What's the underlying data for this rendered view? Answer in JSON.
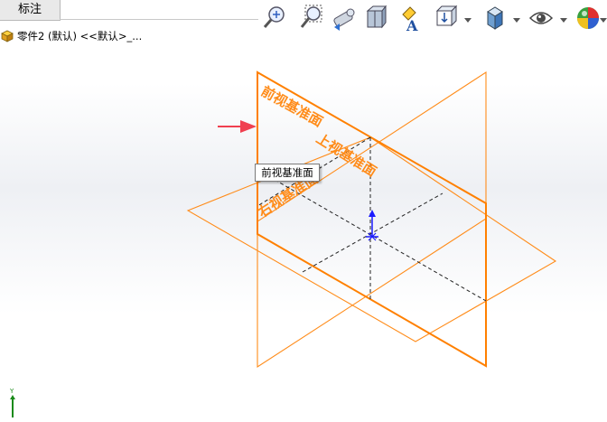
{
  "tabs": {
    "annotation_label": "标注"
  },
  "tree": {
    "part_label": "零件2 (默认) <<默认>_..."
  },
  "planes": {
    "front": "前视基准面",
    "top": "上视基准面",
    "right": "右视基准面"
  },
  "tooltip": {
    "text": "前视基准面"
  },
  "triad": {
    "y_label": "Y"
  },
  "colors": {
    "plane": "#ff8c1a",
    "plane_selected": "#ff8000",
    "pointer_arrow": "#f04050",
    "origin": "#1a1aff"
  },
  "toolbar_icons": [
    "zoom-to-fit-icon",
    "zoom-to-area-icon",
    "previous-view-icon",
    "section-view-icon",
    "dynamic-annotation-view-icon",
    "view-orientation-icon",
    "display-style-icon",
    "hide-show-items-icon",
    "edit-appearance-icon"
  ]
}
